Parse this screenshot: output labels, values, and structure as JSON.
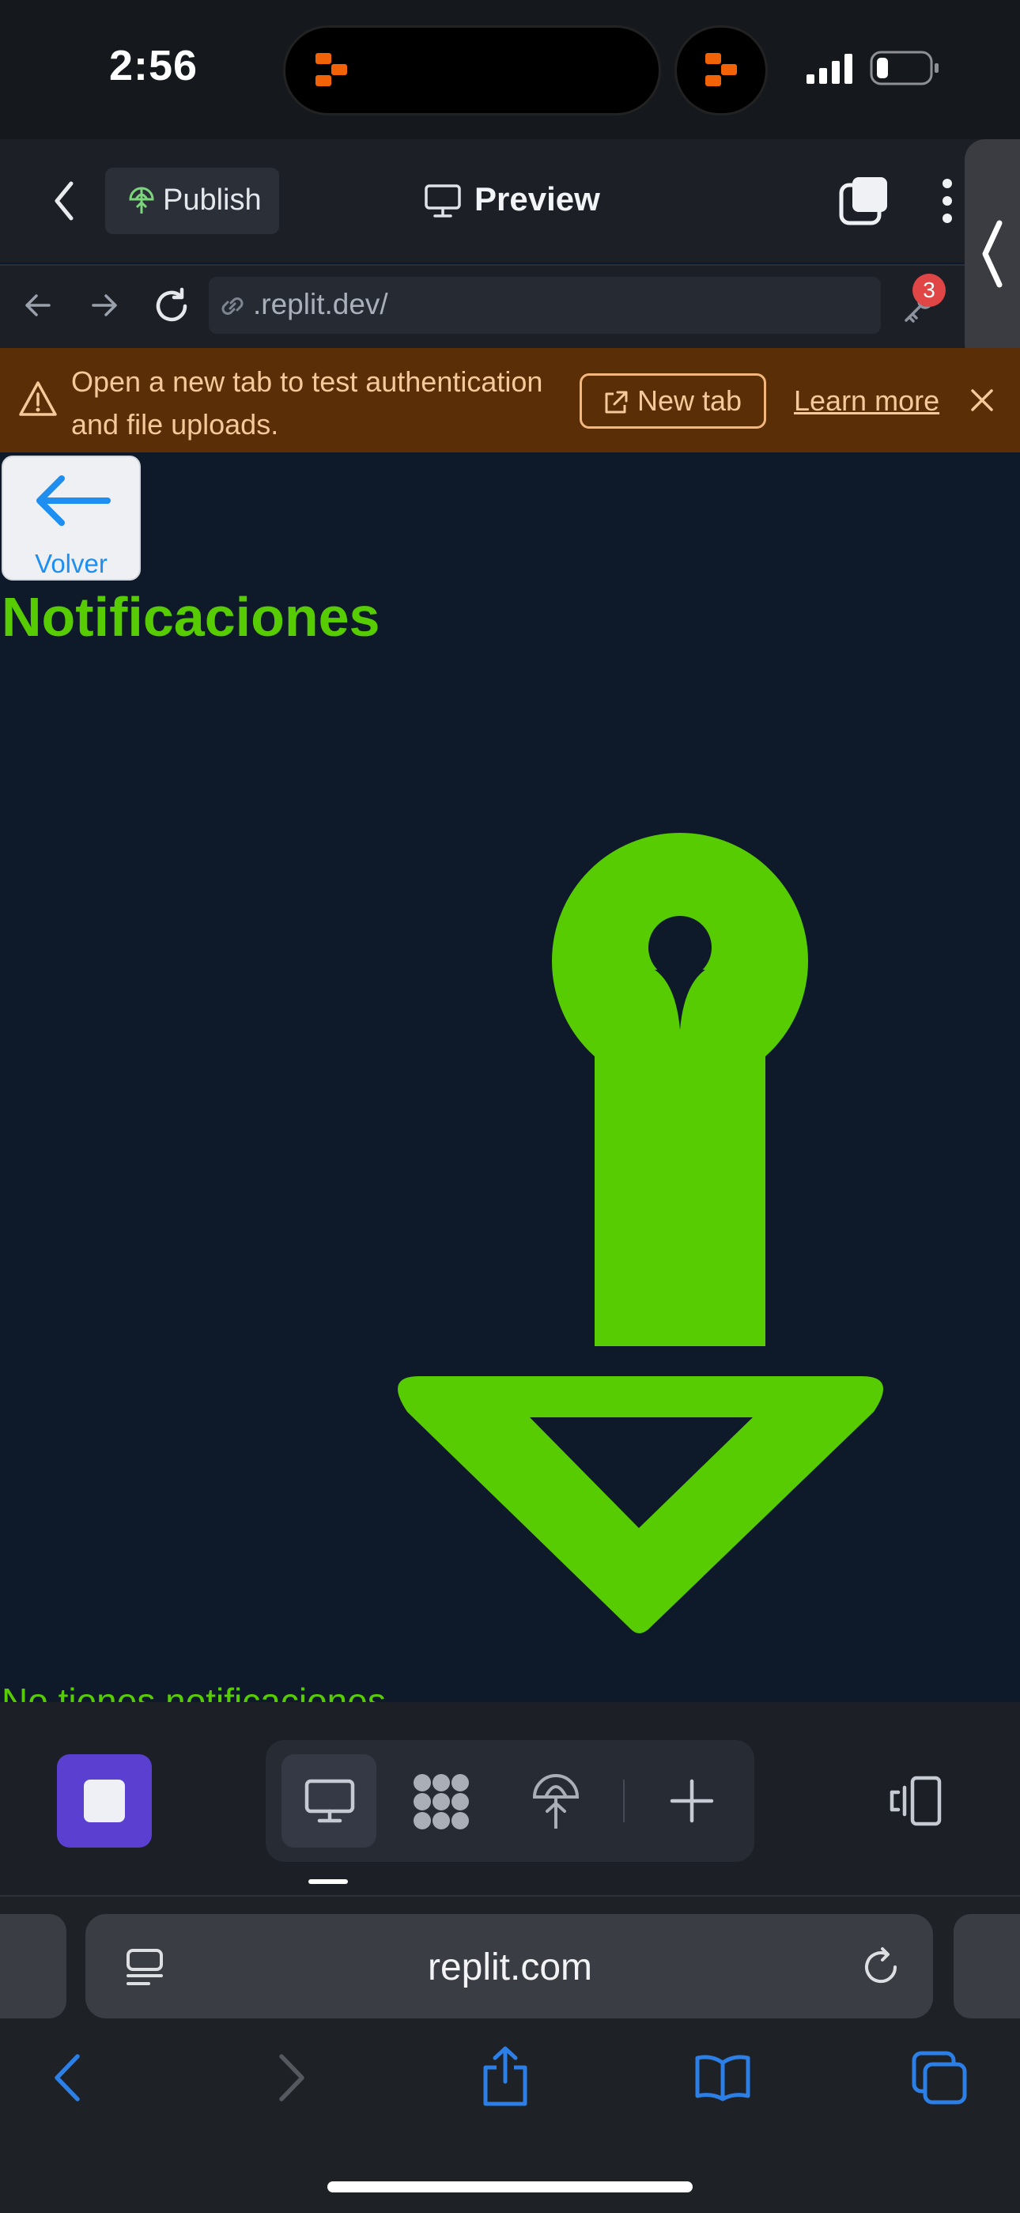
{
  "status_bar": {
    "time": "2:56"
  },
  "header": {
    "publish_label": "Publish",
    "preview_label": "Preview"
  },
  "address_bar": {
    "url": ".replit.dev/",
    "badge_count": "3"
  },
  "banner": {
    "message": "Open a new tab to test authentication and file uploads.",
    "new_tab_label": "New tab",
    "learn_more_label": "Learn more"
  },
  "app": {
    "back_label": "Volver",
    "title": "Notificaciones",
    "empty_message": "No tienes notificaciones",
    "accent_color": "#57cc02"
  },
  "safari": {
    "url": "replit.com"
  },
  "icons": {
    "status": [
      "replit-logo-icon",
      "signal-icon",
      "battery-icon"
    ],
    "header": [
      "chevron-left-icon",
      "globe-icon",
      "monitor-icon",
      "windows-icon",
      "more-vertical-icon"
    ],
    "nav": [
      "arrow-left-icon",
      "arrow-right-icon",
      "reload-icon",
      "link-icon",
      "key-icon"
    ],
    "toolbar": [
      "stop-icon",
      "monitor-icon",
      "apps-icon",
      "publish-icon",
      "plus-icon",
      "device-icon"
    ],
    "safari": [
      "tab-layout-icon",
      "reload-icon",
      "back-icon",
      "forward-icon",
      "share-icon",
      "bookmarks-icon",
      "tabs-icon"
    ]
  }
}
